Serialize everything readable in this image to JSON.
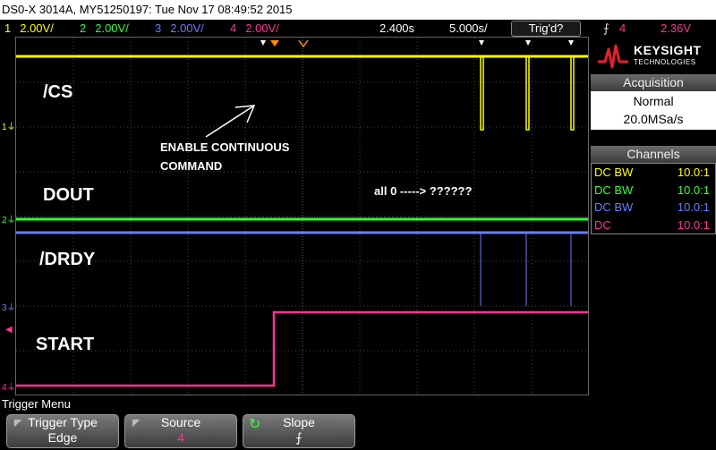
{
  "title": "DS0-X 3014A, MY51250197: Tue Nov 17 08:49:52 2015",
  "status": {
    "channels": [
      {
        "num": "1",
        "scale": "2.00V/",
        "color": "#ffff00"
      },
      {
        "num": "2",
        "scale": "2.00V/",
        "color": "#33ff33"
      },
      {
        "num": "3",
        "scale": "2.00V/",
        "color": "#6b7cff"
      },
      {
        "num": "4",
        "scale": "2.00V/",
        "color": "#ff3399"
      }
    ],
    "time_pos": "2.400s",
    "time_scale": "5.000s/",
    "trig_state": "Trig'd?",
    "trig_icon": "rising-edge-icon",
    "trig_source": "4",
    "trig_level": "2.36V"
  },
  "logo": {
    "name": "KEYSIGHT",
    "sub": "TECHNOLOGIES"
  },
  "acquisition": {
    "header": "Acquisition",
    "mode": "Normal",
    "rate": "20.0MSa/s"
  },
  "channels_panel": {
    "header": "Channels",
    "rows": [
      {
        "label": "DC BW",
        "probe": "10.0:1",
        "color": "#ffff00"
      },
      {
        "label": "DC BW",
        "probe": "10.0:1",
        "color": "#33ff33"
      },
      {
        "label": "DC BW",
        "probe": "10.0:1",
        "color": "#6b7cff"
      },
      {
        "label": "DC",
        "probe": "10.0:1",
        "color": "#ff3399"
      }
    ]
  },
  "annotations": {
    "cs": "/CS",
    "dout": "DOUT",
    "drdy": "/DRDY",
    "start": "START",
    "enable_line1": "ENABLE CONTINUOUS",
    "enable_line2": "COMMAND",
    "all0": "all 0 -----> ??????"
  },
  "markers": {
    "ch1": "1",
    "ch2": "2",
    "ch3": "3",
    "ch4": "4"
  },
  "menu": {
    "title": "Trigger Menu",
    "softkeys": [
      {
        "label": "Trigger Type",
        "value": "Edge"
      },
      {
        "label": "Source",
        "value": "4"
      },
      {
        "label": "Slope",
        "value": "⨍"
      }
    ]
  }
}
